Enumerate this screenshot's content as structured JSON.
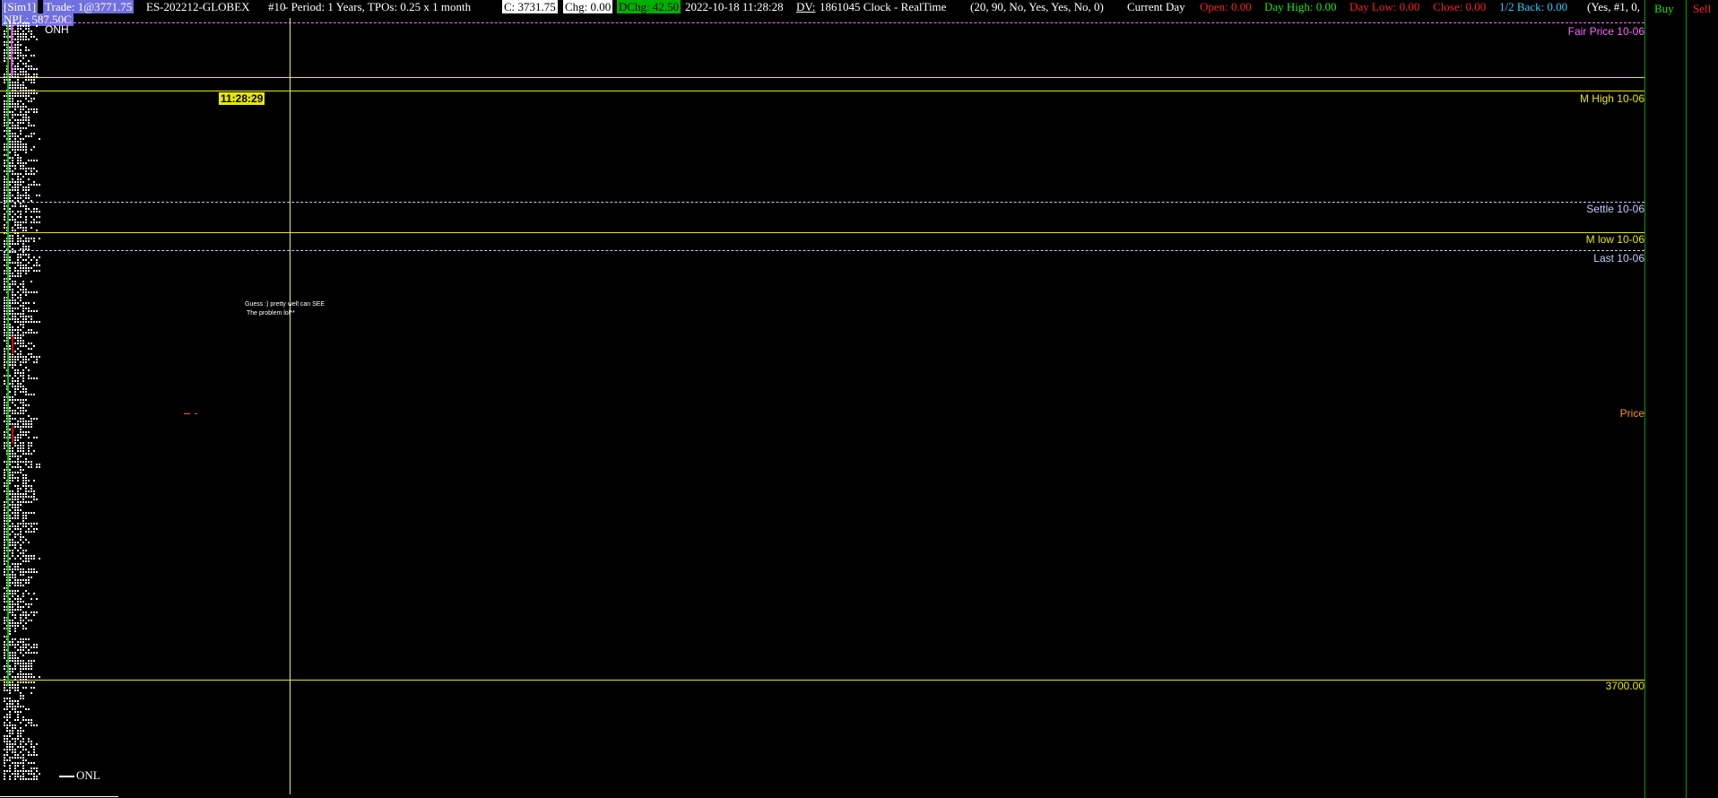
{
  "header": {
    "account": "[Sim1]",
    "trade": "Trade: 1@3771.75",
    "npl": "NPL: 587.50C",
    "symbol": "ES-202212-GLOBEX",
    "chart_number": "#10",
    "period": "- Period: 1 Years, TPOs: 0.25 x 1 month",
    "current_price": "C: 3731.75",
    "change": "Chg: 0.00",
    "dchange": "DChg: 42.50",
    "datetime": "2022-10-18 11:28:28",
    "dv_label": "DV:",
    "dv_value": "1861045 Clock - RealTime",
    "params": "(20, 90, No, Yes, Yes, No, 0)",
    "current_day": "Current Day",
    "open": "Open: 0.00",
    "day_high": "Day High: 0.00",
    "day_low": "Day Low: 0.00",
    "close": "Close: 0.00",
    "half_back": "1/2 Back: 0.00",
    "tail": "(Yes, #1, 0,"
  },
  "chart": {
    "time_cursor": "11:28:29",
    "labels": {
      "onh": "ONH",
      "onl": "ONL",
      "fair_price": "Fair Price 10-06",
      "m_high": "M High 10-06",
      "settle": "Settle 10-06",
      "m_low": "M low 10-06",
      "last": "Last 10-06",
      "price": "Price",
      "price_3700": "3700.00"
    },
    "annotation_line1": "Guess :) pretty well can SEE",
    "annotation_line2": "The problem lol**"
  },
  "side": {
    "buy_label": "Buy",
    "sell_label": "Sell"
  },
  "colors": {
    "yellow": "#e8e800",
    "fair_price": "#ff66ff",
    "dashed_lavender": "#c8c8ff",
    "price_orange": "#ff9900",
    "panel_green": "#00a000",
    "header_red": "#ff2020",
    "header_green": "#20e020",
    "header_cyan": "#20d0ff"
  },
  "icons": {
    "onl_marker": "horizontal-line-marker"
  }
}
